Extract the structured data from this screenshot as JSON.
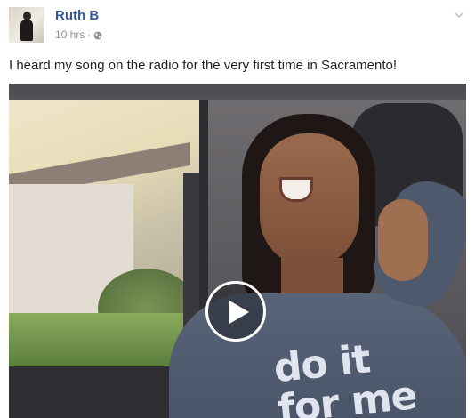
{
  "post": {
    "author": "Ruth B",
    "time": "10 hrs",
    "separator": "·",
    "text": "I heard my song on the radio for the very first time in Sacramento!"
  },
  "video": {
    "sweater_text": "do it for me"
  },
  "icons": {
    "privacy": "globe-icon",
    "menu": "chevron-down-icon",
    "play": "play-icon"
  },
  "colors": {
    "author_link": "#365899",
    "meta_text": "#90949c",
    "body_text": "#1d2129"
  }
}
